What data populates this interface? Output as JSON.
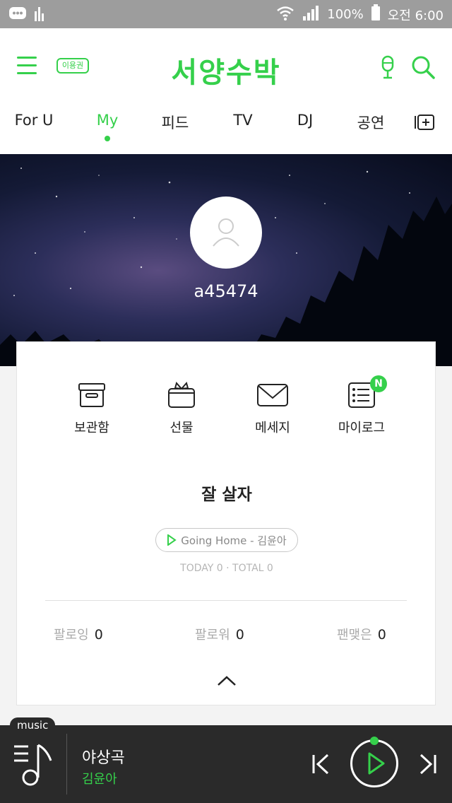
{
  "status_bar": {
    "battery": "100%",
    "time": "오전 6:00"
  },
  "header": {
    "ticket_label": "이용권",
    "logo": "서양수박"
  },
  "tabs": [
    {
      "label": "For U",
      "active": false
    },
    {
      "label": "My",
      "active": true
    },
    {
      "label": "피드",
      "active": false
    },
    {
      "label": "TV",
      "active": false
    },
    {
      "label": "DJ",
      "active": false
    },
    {
      "label": "공연",
      "active": false
    }
  ],
  "profile": {
    "username": "a45474"
  },
  "actions": [
    {
      "label": "보관함",
      "icon": "archive-icon"
    },
    {
      "label": "선물",
      "icon": "gift-icon"
    },
    {
      "label": "메세지",
      "icon": "message-icon"
    },
    {
      "label": "마이로그",
      "icon": "mylog-icon",
      "badge": "N"
    }
  ],
  "status_message": "잘 살자",
  "profile_song": "Going Home - 김윤아",
  "visits": {
    "today_label": "TODAY",
    "today": "0",
    "total_label": "TOTAL",
    "total": "0"
  },
  "follow": [
    {
      "label": "팔로잉",
      "count": "0"
    },
    {
      "label": "팔로워",
      "count": "0"
    },
    {
      "label": "팬맺은",
      "count": "0"
    }
  ],
  "player": {
    "tag": "music",
    "title": "야상곡",
    "artist": "김윤아"
  },
  "colors": {
    "accent": "#35d04b",
    "player_bg": "#2a2a2a",
    "status_bar": "#9d9d9d"
  }
}
